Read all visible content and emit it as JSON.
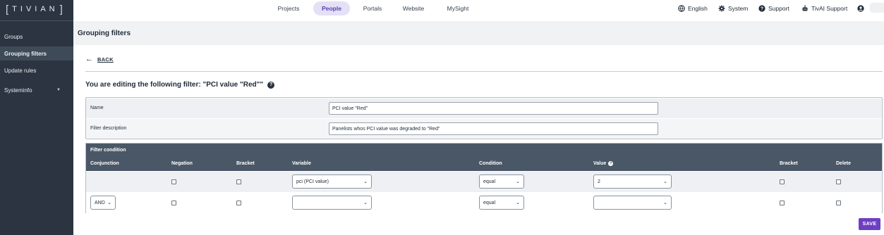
{
  "brand": {
    "logo_text": "TIVIAN"
  },
  "sidebar": {
    "items": [
      {
        "label": "Groups"
      },
      {
        "label": "Grouping filters"
      },
      {
        "label": "Update rules"
      },
      {
        "label": "Systeminfo"
      }
    ]
  },
  "topnav": {
    "tabs": [
      "Projects",
      "People",
      "Portals",
      "Website",
      "MySight"
    ],
    "active_tab": "People",
    "right": {
      "language": "English",
      "system": "System",
      "support": "Support",
      "ai_support": "TivAI Support"
    }
  },
  "page": {
    "title": "Grouping filters",
    "back_label": "BACK",
    "editing_title": "You are editing the following filter: \"PCI value \"Red\"\""
  },
  "filter_info": {
    "name_label": "Name",
    "name_value": "PCI value \"Red\"",
    "description_label": "Filter description",
    "description_value": "Panelists whos PCI value was degraded to \"Red\""
  },
  "conditions": {
    "title": "Filter condition",
    "columns": [
      "Conjunction",
      "Negation",
      "Bracket",
      "Variable",
      "Condition",
      "Value",
      "Bracket",
      "Delete"
    ],
    "rows": [
      {
        "conjunction": "",
        "variable": "pci (PCI value)",
        "condition": "equal",
        "value": "2"
      },
      {
        "conjunction": "AND",
        "variable": "",
        "condition": "equal",
        "value": ""
      }
    ]
  },
  "actions": {
    "save_label": "SAVE"
  },
  "colors": {
    "sidebar": "#2b3440",
    "accent": "#6d3fc1",
    "table_header": "#4a5767"
  }
}
